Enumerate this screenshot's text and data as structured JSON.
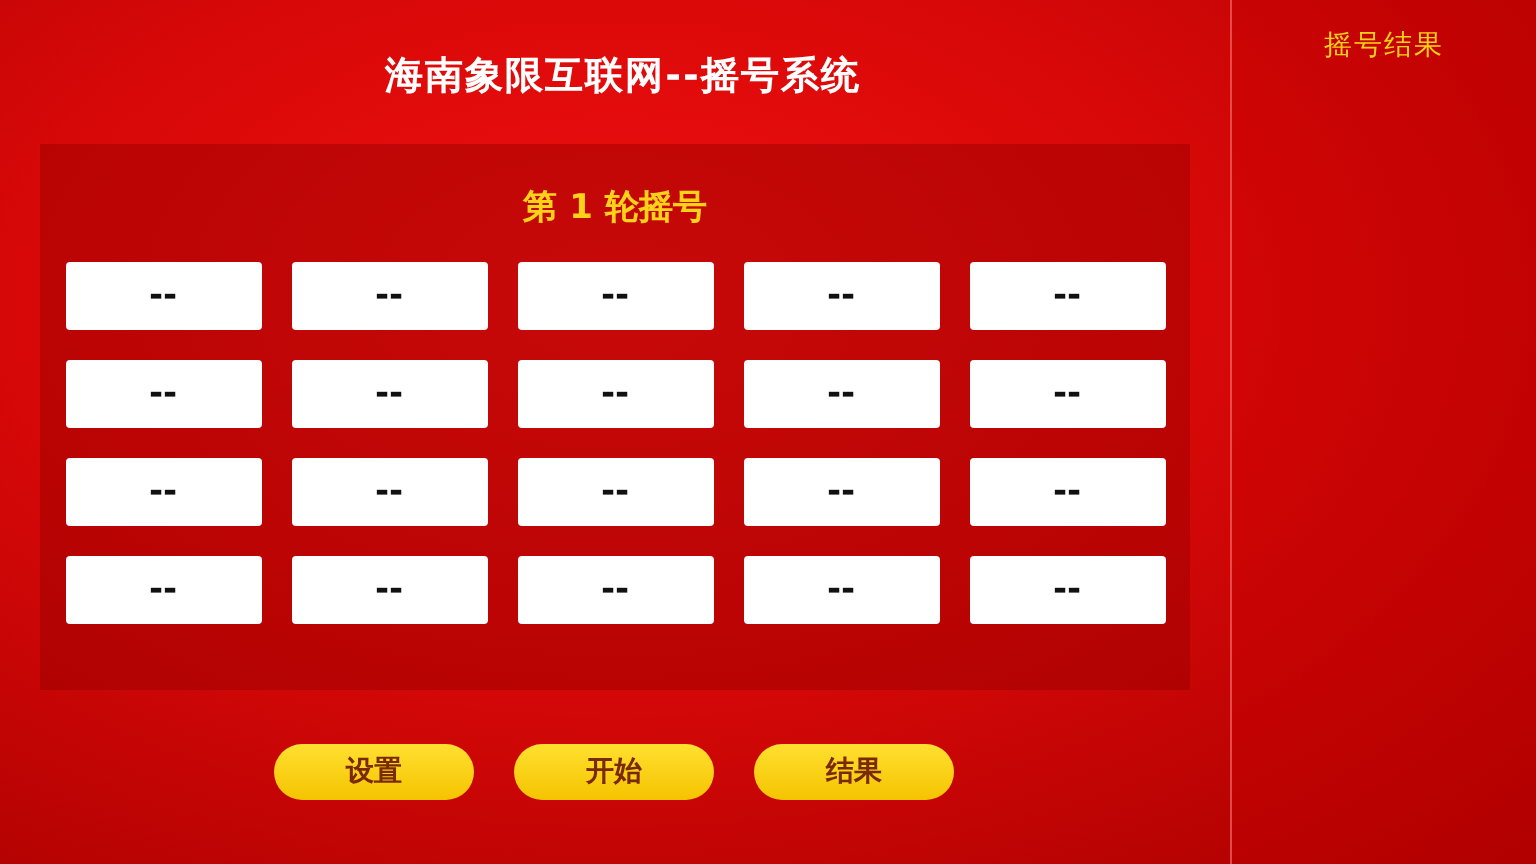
{
  "title": "海南象限互联网--摇号系统",
  "round_title": "第 1 轮摇号",
  "cells": [
    "--",
    "--",
    "--",
    "--",
    "--",
    "--",
    "--",
    "--",
    "--",
    "--",
    "--",
    "--",
    "--",
    "--",
    "--",
    "--",
    "--",
    "--",
    "--",
    "--"
  ],
  "buttons": [
    "设置",
    "开始",
    "结果"
  ],
  "results_panel": {
    "title": "摇号结果"
  }
}
